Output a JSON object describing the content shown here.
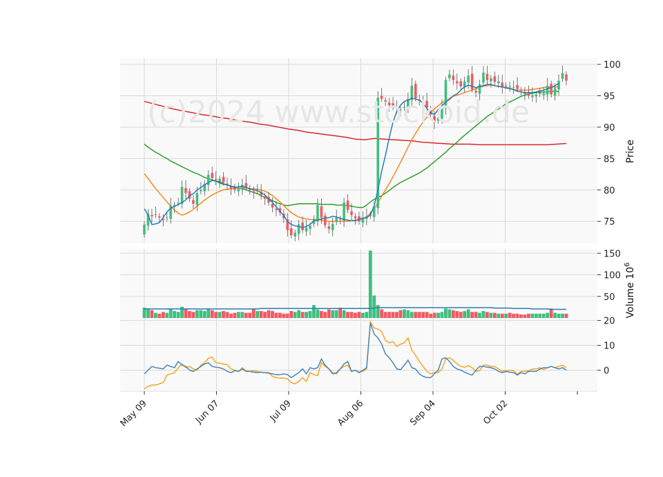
{
  "chart_data": {
    "type": "candlestick",
    "watermark": "(c)2024 www.stockoid.de",
    "x_ticks": [
      "May 09",
      "Jun 07",
      "Jul 09",
      "Aug 06",
      "Sep 04",
      "Oct 02"
    ],
    "colors": {
      "up": "#3fbf7f",
      "down": "#f05a63",
      "ma_fast": "#2a7ab8",
      "ma_mid": "#f5871f",
      "ma_slow": "#2ca02c",
      "ma_long": "#d62728",
      "osc_a": "#f5a623",
      "osc_b": "#4a86b8",
      "vol_avg": "#2a7ab8"
    },
    "price_panel": {
      "ylabel": "Price",
      "yticks": [
        75,
        80,
        85,
        90,
        95,
        100
      ],
      "ylim": [
        71.5,
        101
      ]
    },
    "volume_panel": {
      "ylabel": "Volume",
      "ylabel_exp": "6",
      "yticks": [
        50,
        100,
        150
      ],
      "ylim": [
        0,
        160
      ]
    },
    "osc_panel": {
      "yticks": [
        0,
        10,
        20
      ],
      "ylim": [
        -8.5,
        21
      ]
    },
    "close": [
      74.5,
      76.2,
      75.8,
      76.0,
      75.6,
      75.2,
      75.6,
      77.5,
      77.6,
      78.0,
      80.5,
      79.5,
      78.6,
      77.8,
      79.5,
      80.0,
      81.0,
      82.4,
      81.9,
      81.5,
      81.8,
      81.2,
      80.8,
      80.2,
      80.0,
      80.4,
      80.8,
      80.5,
      80.0,
      79.6,
      79.9,
      79.2,
      78.6,
      78.0,
      77.2,
      76.8,
      76.4,
      75.5,
      73.6,
      72.8,
      73.2,
      74.5,
      73.6,
      74.0,
      74.3,
      75.2,
      77.6,
      75.6,
      74.4,
      73.8,
      74.6,
      75.6,
      75.3,
      78.0,
      76.8,
      76.0,
      75.5,
      75.0,
      75.6,
      75.8,
      75.9,
      77.3,
      94.7,
      94.5,
      94.1,
      93.5,
      93.2,
      92.9,
      92.8,
      93.2,
      94.5,
      96.6,
      94.6,
      94.2,
      93.9,
      93.1,
      92.0,
      90.7,
      91.5,
      93.2,
      97.5,
      98.4,
      97.5,
      97.0,
      96.5,
      97.3,
      98.2,
      96.0,
      95.5,
      96.8,
      98.7,
      97.5,
      97.8,
      97.2,
      97.3,
      96.3,
      96.6,
      96.5,
      96.4,
      96.1,
      95.8,
      95.3,
      95.0,
      95.1,
      95.2,
      95.3,
      95.4,
      96.6,
      95.2,
      96.2,
      97.4,
      98.6,
      97.4
    ],
    "ma_fast": [
      77.0,
      76.0,
      74.5,
      74.6,
      74.8,
      75.6,
      76.5,
      77.1,
      77.4,
      77.7,
      78.0,
      78.4,
      79.1,
      79.4,
      80.0,
      80.4,
      80.8,
      81.2,
      81.5,
      81.4,
      81.3,
      81.0,
      80.8,
      80.6,
      80.4,
      80.5,
      80.6,
      80.4,
      80.2,
      80.0,
      79.9,
      79.6,
      79.2,
      78.6,
      78.0,
      77.3,
      76.6,
      75.9,
      75.0,
      74.5,
      74.3,
      74.2,
      74.0,
      74.2,
      74.5,
      75.1,
      75.2,
      75.4,
      75.5,
      75.6,
      75.8,
      75.7,
      75.5,
      75.3,
      75.2,
      75.1,
      75.1,
      75.3,
      75.5,
      75.6,
      76.0,
      77.5,
      80.0,
      83.0,
      85.5,
      88.3,
      90.8,
      92.5,
      93.5,
      94.1,
      94.3,
      94.6,
      94.5,
      94.3,
      93.8,
      93.0,
      92.3,
      92.0,
      92.8,
      93.4,
      94.0,
      94.4,
      95.0,
      95.3,
      95.9,
      96.4,
      96.7,
      96.5,
      96.3,
      96.5,
      96.6,
      96.8,
      96.8,
      96.6,
      96.5,
      96.4,
      96.3,
      96.2,
      96.0,
      95.7,
      95.6,
      95.5,
      95.5,
      95.5,
      95.6,
      95.8,
      95.9,
      96.1,
      96.3,
      96.6,
      97.0
    ],
    "ma_mid": [
      82.6,
      81.8,
      81.0,
      80.2,
      79.5,
      78.8,
      78.1,
      77.4,
      76.8,
      76.3,
      76.0,
      76.2,
      76.5,
      76.9,
      77.4,
      77.9,
      78.4,
      78.8,
      79.2,
      79.5,
      79.8,
      80.0,
      80.1,
      80.2,
      80.3,
      80.3,
      80.3,
      80.3,
      80.2,
      80.2,
      80.1,
      80.0,
      79.8,
      79.5,
      79.1,
      78.6,
      78.1,
      77.5,
      76.9,
      76.4,
      76.0,
      75.7,
      75.5,
      75.4,
      75.3,
      75.3,
      75.3,
      75.2,
      75.1,
      75.0,
      75.0,
      75.0,
      75.0,
      75.0,
      75.0,
      75.1,
      75.2,
      75.3,
      75.4,
      75.7,
      76.3,
      77.0,
      78.0,
      79.0,
      80.0,
      81.0,
      82.1,
      83.2,
      84.4,
      85.6,
      86.8,
      88.0,
      89.0,
      90.0,
      90.8,
      91.6,
      92.3,
      92.9,
      93.4,
      93.9,
      94.2,
      94.6,
      94.9,
      95.1,
      95.3,
      95.5,
      95.7,
      95.9,
      96.1,
      96.3,
      96.5,
      96.6,
      96.7,
      96.6,
      96.5,
      96.4,
      96.2,
      96.1,
      96.0,
      95.9,
      95.9,
      95.9,
      95.9,
      96.0,
      96.1,
      96.2,
      96.3,
      96.4,
      96.4,
      96.4,
      96.4
    ],
    "ma_slow": [
      87.3,
      86.8,
      86.4,
      86.0,
      85.7,
      85.3,
      85.0,
      84.6,
      84.3,
      84.0,
      83.7,
      83.4,
      83.1,
      82.8,
      82.6,
      82.3,
      82.0,
      81.8,
      81.6,
      81.4,
      81.1,
      80.9,
      80.8,
      80.6,
      80.5,
      80.3,
      80.2,
      80.0,
      79.8,
      79.6,
      79.4,
      79.1,
      78.8,
      78.6,
      78.3,
      78.0,
      77.8,
      77.6,
      77.5,
      77.6,
      77.7,
      77.8,
      77.8,
      77.8,
      77.8,
      77.8,
      77.8,
      77.7,
      77.7,
      77.7,
      77.7,
      77.6,
      77.6,
      77.6,
      77.5,
      77.4,
      77.3,
      77.2,
      77.2,
      77.6,
      78.1,
      78.5,
      78.8,
      79.1,
      79.5,
      79.9,
      80.4,
      80.8,
      81.2,
      81.5,
      81.8,
      82.1,
      82.4,
      82.7,
      83.1,
      83.5,
      84.0,
      84.5,
      85.0,
      85.5,
      86.0,
      86.6,
      87.1,
      87.6,
      88.2,
      88.7,
      89.2,
      89.7,
      90.2,
      90.7,
      91.2,
      91.7,
      92.1,
      92.5,
      92.9,
      93.3,
      93.7,
      94.0,
      94.3,
      94.6,
      94.9,
      95.1,
      95.3,
      95.4,
      95.5,
      95.6,
      95.6,
      95.6,
      95.7,
      95.7,
      95.7
    ],
    "ma_long": [
      94.1,
      93.7,
      93.3,
      92.9,
      92.6,
      92.3,
      92.0,
      91.8,
      91.5,
      91.3,
      91.0,
      90.8,
      90.5,
      90.3,
      90.0,
      89.7,
      89.5,
      89.2,
      89.0,
      88.8,
      88.6,
      88.4,
      88.1,
      88.0,
      88.2,
      88.1,
      88.0,
      87.9,
      87.8,
      87.6,
      87.5,
      87.4,
      87.3,
      87.3,
      87.3,
      87.2,
      87.2,
      87.2,
      87.2,
      87.2,
      87.2,
      87.2,
      87.2,
      87.3,
      87.4
    ],
    "volume": [
      24,
      20,
      18,
      12,
      10,
      14,
      12,
      20,
      16,
      14,
      26,
      20,
      16,
      14,
      18,
      18,
      16,
      20,
      18,
      14,
      14,
      16,
      14,
      10,
      12,
      14,
      14,
      12,
      12,
      20,
      16,
      16,
      14,
      18,
      16,
      12,
      12,
      10,
      10,
      16,
      14,
      18,
      14,
      14,
      16,
      30,
      20,
      16,
      14,
      20,
      18,
      18,
      24,
      18,
      14,
      14,
      12,
      14,
      12,
      14,
      156,
      52,
      30,
      20,
      14,
      14,
      14,
      14,
      18,
      20,
      18,
      14,
      14,
      14,
      14,
      14,
      10,
      12,
      12,
      14,
      22,
      20,
      18,
      16,
      14,
      16,
      20,
      14,
      14,
      12,
      16,
      14,
      12,
      12,
      10,
      10,
      10,
      12,
      10,
      10,
      8,
      8,
      10,
      10,
      10,
      10,
      10,
      12,
      22,
      12,
      10,
      10,
      10
    ],
    "volume_avg": [
      21,
      21,
      21,
      21,
      21,
      21,
      21,
      21,
      21,
      21,
      21,
      21,
      21,
      21,
      21,
      21,
      21,
      21,
      21,
      21,
      21,
      21,
      21,
      21,
      21,
      21,
      21,
      21,
      21,
      21,
      21,
      22,
      22,
      22,
      22,
      22,
      22,
      22,
      22,
      22,
      22,
      22,
      22,
      22,
      22,
      22,
      22,
      22,
      22,
      22,
      22,
      22,
      22,
      22,
      22,
      22,
      22,
      22,
      22,
      22,
      22,
      23,
      24,
      24,
      24,
      24,
      24,
      24,
      24,
      24,
      24,
      24,
      24,
      24,
      24,
      24,
      24,
      24,
      24,
      24,
      24,
      24,
      24,
      24,
      24,
      24,
      24,
      24,
      24,
      24,
      24,
      24,
      24,
      23,
      23,
      23,
      23,
      23,
      22,
      22,
      22,
      22,
      22,
      21,
      21,
      21,
      21,
      21,
      20,
      20,
      20,
      20,
      20
    ],
    "osc_a": [
      -7.5,
      -6.5,
      -6.0,
      -6.0,
      -5.5,
      -5.0,
      -2.0,
      -1.5,
      -1.0,
      1.0,
      2.5,
      1.0,
      1.5,
      0.5,
      0.0,
      2.0,
      3.0,
      4.8,
      5.2,
      3.0,
      2.8,
      2.5,
      2.2,
      0.5,
      0.0,
      -0.5,
      1.0,
      -0.3,
      -0.5,
      -0.2,
      -0.5,
      -0.8,
      -1.0,
      -1.0,
      -2.5,
      -3.0,
      -3.2,
      -3.2,
      -3.5,
      -5.0,
      -5.5,
      -4.5,
      -3.0,
      -4.5,
      -1.0,
      -1.8,
      -2.2,
      3.0,
      1.5,
      0.5,
      -1.0,
      -1.5,
      0.5,
      1.5,
      2.0,
      -0.5,
      0.0,
      -0.8,
      -0.5,
      0.5,
      19.5,
      17.0,
      16.5,
      15.5,
      12.0,
      11.0,
      11.5,
      9.5,
      10.5,
      11.0,
      13.0,
      8.0,
      6.0,
      3.5,
      1.5,
      -0.5,
      -1.5,
      -1.0,
      -1.0,
      0.5,
      4.5,
      5.0,
      4.0,
      2.5,
      1.5,
      1.2,
      1.8,
      1.0,
      -0.5,
      -0.2,
      2.0,
      2.0,
      1.5,
      1.5,
      0.5,
      -0.5,
      -0.2,
      0.0,
      -0.3,
      -1.5,
      -0.5,
      -0.5,
      -0.2,
      0.5,
      0.5,
      1.0,
      0.2,
      1.0,
      1.5,
      1.0,
      1.5,
      2.0,
      1.0
    ],
    "osc_b": [
      -1.5,
      0.0,
      1.5,
      1.0,
      0.8,
      0.5,
      2.0,
      1.5,
      1.0,
      3.5,
      2.0,
      1.5,
      0.0,
      -0.5,
      0.5,
      1.5,
      2.5,
      3.0,
      1.5,
      1.2,
      1.0,
      0.5,
      -0.5,
      -1.0,
      -0.2,
      -0.5,
      0.5,
      -0.5,
      -0.5,
      -0.8,
      -1.0,
      -0.8,
      -1.0,
      -1.2,
      -1.5,
      -1.8,
      -1.8,
      -1.5,
      -1.8,
      -3.0,
      -2.0,
      -1.0,
      0.5,
      -1.5,
      1.0,
      0.5,
      1.0,
      4.5,
      2.0,
      0.5,
      -1.5,
      -1.0,
      0.5,
      2.5,
      3.5,
      -0.5,
      0.0,
      -1.0,
      0.0,
      1.0,
      19.0,
      14.5,
      13.0,
      10.5,
      6.5,
      5.0,
      3.0,
      0.5,
      0.2,
      2.0,
      4.0,
      1.0,
      0.5,
      -1.5,
      -2.5,
      -3.0,
      -3.0,
      -1.5,
      0.0,
      4.5,
      5.0,
      3.5,
      1.5,
      0.5,
      0.0,
      -0.8,
      -1.5,
      -2.0,
      0.0,
      1.5,
      1.5,
      1.2,
      1.0,
      0.5,
      -0.5,
      -1.0,
      -0.5,
      -0.8,
      -1.0,
      -2.0,
      -1.0,
      -1.5,
      -0.5,
      -0.5,
      -0.5,
      0.5,
      1.0,
      1.0,
      1.5,
      1.0,
      0.5,
      1.0,
      0.0
    ]
  }
}
